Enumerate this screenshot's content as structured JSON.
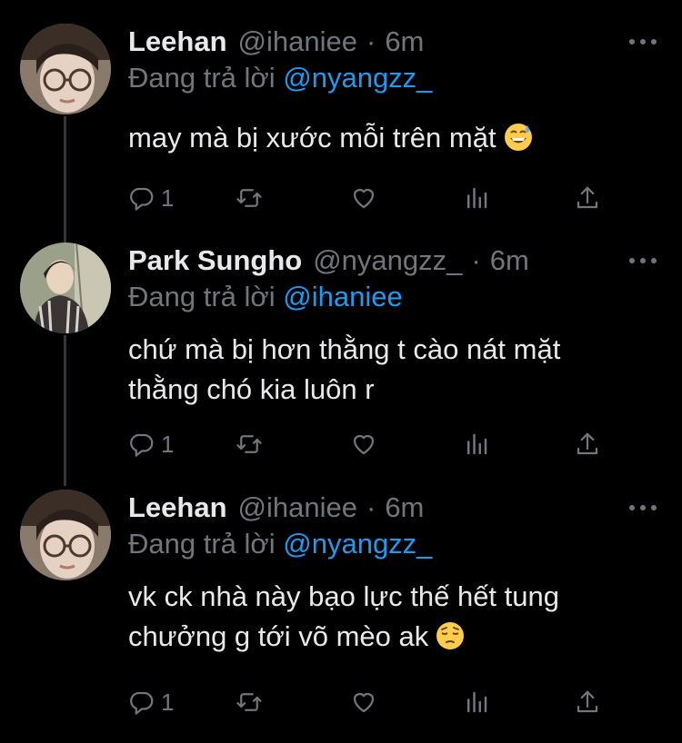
{
  "tweets": [
    {
      "name": "Leehan",
      "handle": "@ihaniee",
      "sep": "·",
      "time": "6m",
      "reply_prefix": "Đang trả lời",
      "reply_to": "@nyangzz_",
      "lines": [
        "may mà bị xước mỗi trên mặt"
      ],
      "emoji": "grinning-sweat-emoji",
      "reply_count": "1",
      "avatar": "leehan-avatar"
    },
    {
      "name": "Park Sungho",
      "handle": "@nyangzz_",
      "sep": "·",
      "time": "6m",
      "reply_prefix": "Đang trả lời",
      "reply_to": "@ihaniee",
      "lines": [
        "chứ mà bị hơn thằng t cào nát mặt",
        "thằng chó kia luôn r"
      ],
      "emoji": "",
      "reply_count": "1",
      "avatar": "park-sungho-avatar"
    },
    {
      "name": "Leehan",
      "handle": "@ihaniee",
      "sep": "·",
      "time": "6m",
      "reply_prefix": "Đang trả lời",
      "reply_to": "@nyangzz_",
      "lines": [
        "vk ck nhà này bạo lực thế hết tung",
        "chưởng g tới võ mèo ak"
      ],
      "emoji": "pensive-emoji",
      "reply_count": "1",
      "avatar": "leehan-avatar"
    }
  ],
  "icons": {
    "reply": "reply-icon",
    "retweet": "retweet-icon",
    "like": "heart-icon",
    "views": "views-icon",
    "share": "share-icon",
    "more": "more-icon"
  },
  "colors": {
    "background": "#000000",
    "text": "#e7e9ea",
    "muted": "#71767b",
    "link": "#1d9bf0",
    "thread_line": "#333639"
  }
}
